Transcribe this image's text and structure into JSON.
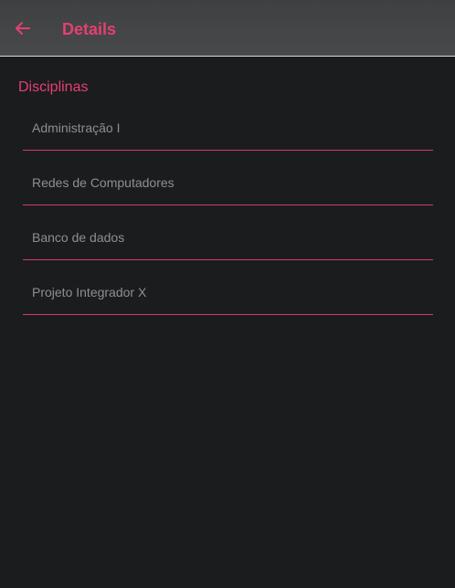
{
  "header": {
    "title": "Details",
    "back_icon": "arrow-left-icon"
  },
  "section": {
    "title": "Disciplinas"
  },
  "items": [
    {
      "label": "Administração I"
    },
    {
      "label": "Redes de Computadores"
    },
    {
      "label": "Banco de dados"
    },
    {
      "label": "Projeto Integrador X"
    }
  ],
  "colors": {
    "accent": "#e53f73",
    "background": "#1b1c1e",
    "header": "#45464a",
    "item_text": "#8e8f91"
  }
}
